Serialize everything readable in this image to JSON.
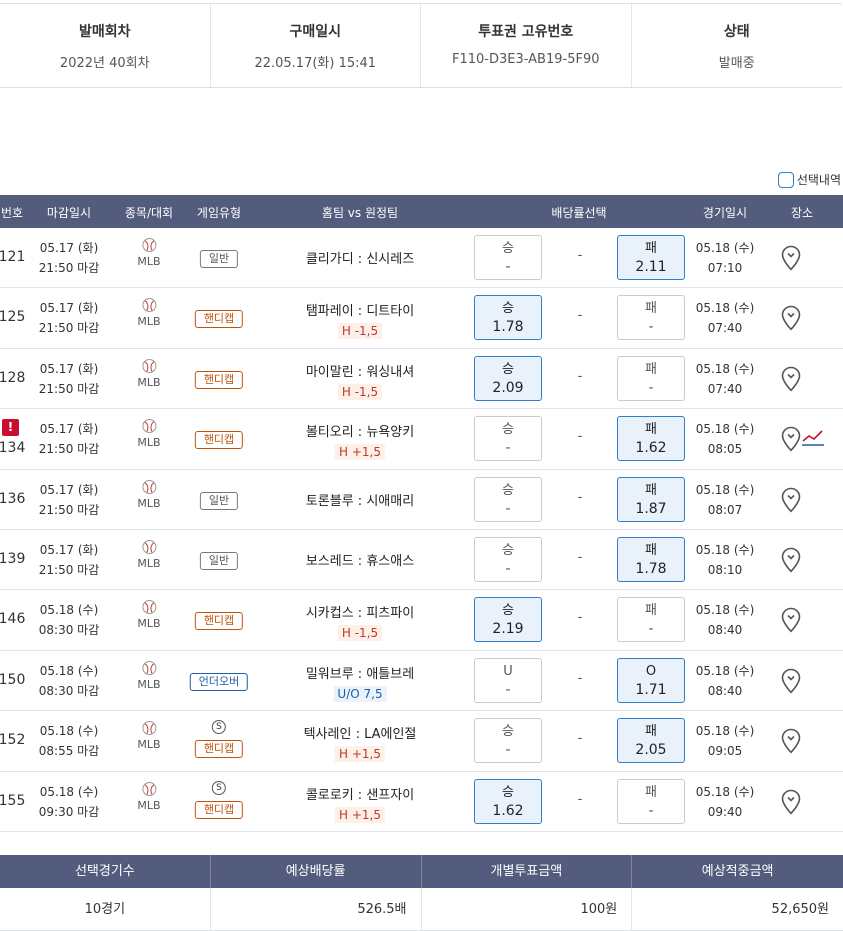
{
  "info": [
    {
      "label": "발매회차",
      "value": "2022년 40회차"
    },
    {
      "label": "구매일시",
      "value": "22.05.17(화) 15:41"
    },
    {
      "label": "투표권 고유번호",
      "value": "F110-D3E3-AB19-5F90"
    },
    {
      "label": "상태",
      "value": "발매중"
    }
  ],
  "select_toggle": "선택내역",
  "headers": {
    "num": "번호",
    "deadline": "마감일시",
    "sport": "종목/대회",
    "type": "게임유형",
    "teams": "홈팀 vs 원정팀",
    "odds": "배당률선택",
    "gametime": "경기일시",
    "venue": "장소"
  },
  "rows": [
    {
      "num": "121",
      "d1": "05.17 (화)",
      "d2": "21:50 마감",
      "sport": "MLB",
      "type": "일반",
      "kind": "normal",
      "teams": "클리가디 : 신시레즈",
      "sub": "",
      "left_label": "승",
      "left_val": "-",
      "left_sel": false,
      "mid": "-",
      "right_label": "패",
      "right_val": "2.11",
      "right_sel": true,
      "g1": "05.18 (수)",
      "g2": "07:10",
      "alert": "",
      "special": ""
    },
    {
      "num": "125",
      "d1": "05.17 (화)",
      "d2": "21:50 마감",
      "sport": "MLB",
      "type": "핸디캡",
      "kind": "handi",
      "teams": "탬파레이 : 디트타이",
      "sub": "H -1,5",
      "left_label": "승",
      "left_val": "1.78",
      "left_sel": true,
      "mid": "-",
      "right_label": "패",
      "right_val": "-",
      "right_sel": false,
      "g1": "05.18 (수)",
      "g2": "07:40",
      "alert": "",
      "special": ""
    },
    {
      "num": "128",
      "d1": "05.17 (화)",
      "d2": "21:50 마감",
      "sport": "MLB",
      "type": "핸디캡",
      "kind": "handi",
      "teams": "마이말린 : 워싱내셔",
      "sub": "H -1,5",
      "left_label": "승",
      "left_val": "2.09",
      "left_sel": true,
      "mid": "-",
      "right_label": "패",
      "right_val": "-",
      "right_sel": false,
      "g1": "05.18 (수)",
      "g2": "07:40",
      "alert": "",
      "special": ""
    },
    {
      "num": "134",
      "d1": "05.17 (화)",
      "d2": "21:50 마감",
      "sport": "MLB",
      "type": "핸디캡",
      "kind": "handi",
      "teams": "볼티오리 : 뉴욕양키",
      "sub": "H +1,5",
      "left_label": "승",
      "left_val": "-",
      "left_sel": false,
      "mid": "-",
      "right_label": "패",
      "right_val": "1.62",
      "right_sel": true,
      "g1": "05.18 (수)",
      "g2": "08:05",
      "alert": "!",
      "special": ""
    },
    {
      "num": "136",
      "d1": "05.17 (화)",
      "d2": "21:50 마감",
      "sport": "MLB",
      "type": "일반",
      "kind": "normal",
      "teams": "토론블루 : 시애매리",
      "sub": "",
      "left_label": "승",
      "left_val": "-",
      "left_sel": false,
      "mid": "-",
      "right_label": "패",
      "right_val": "1.87",
      "right_sel": true,
      "g1": "05.18 (수)",
      "g2": "08:07",
      "alert": "",
      "special": ""
    },
    {
      "num": "139",
      "d1": "05.17 (화)",
      "d2": "21:50 마감",
      "sport": "MLB",
      "type": "일반",
      "kind": "normal",
      "teams": "보스레드 : 휴스애스",
      "sub": "",
      "left_label": "승",
      "left_val": "-",
      "left_sel": false,
      "mid": "-",
      "right_label": "패",
      "right_val": "1.78",
      "right_sel": true,
      "g1": "05.18 (수)",
      "g2": "08:10",
      "alert": "",
      "special": ""
    },
    {
      "num": "146",
      "d1": "05.18 (수)",
      "d2": "08:30 마감",
      "sport": "MLB",
      "type": "핸디캡",
      "kind": "handi",
      "teams": "시카컵스 : 피츠파이",
      "sub": "H -1,5",
      "left_label": "승",
      "left_val": "2.19",
      "left_sel": true,
      "mid": "-",
      "right_label": "패",
      "right_val": "-",
      "right_sel": false,
      "g1": "05.18 (수)",
      "g2": "08:40",
      "alert": "",
      "special": ""
    },
    {
      "num": "150",
      "d1": "05.18 (수)",
      "d2": "08:30 마감",
      "sport": "MLB",
      "type": "언더오버",
      "kind": "uo",
      "teams": "밀워브루 : 애틀브레",
      "sub": "U/O 7,5",
      "left_label": "U",
      "left_val": "-",
      "left_sel": false,
      "mid": "-",
      "right_label": "O",
      "right_val": "1.71",
      "right_sel": true,
      "g1": "05.18 (수)",
      "g2": "08:40",
      "alert": "",
      "special": ""
    },
    {
      "num": "152",
      "d1": "05.18 (수)",
      "d2": "08:55 마감",
      "sport": "MLB",
      "type": "핸디캡",
      "kind": "handi",
      "teams": "텍사레인 : LA에인절",
      "sub": "H +1,5",
      "left_label": "승",
      "left_val": "-",
      "left_sel": false,
      "mid": "-",
      "right_label": "패",
      "right_val": "2.05",
      "right_sel": true,
      "g1": "05.18 (수)",
      "g2": "09:05",
      "alert": "",
      "special": "S"
    },
    {
      "num": "155",
      "d1": "05.18 (수)",
      "d2": "09:30 마감",
      "sport": "MLB",
      "type": "핸디캡",
      "kind": "handi",
      "teams": "콜로로키 : 샌프자이",
      "sub": "H +1,5",
      "left_label": "승",
      "left_val": "1.62",
      "left_sel": true,
      "mid": "-",
      "right_label": "패",
      "right_val": "-",
      "right_sel": false,
      "g1": "05.18 (수)",
      "g2": "09:40",
      "alert": "",
      "special": "S"
    }
  ],
  "summary": {
    "headers": [
      "선택경기수",
      "예상배당률",
      "개별투표금액",
      "예상적중금액"
    ],
    "values": [
      "10경기",
      "526.5배",
      "100원",
      "52,650원"
    ]
  },
  "colors": {
    "header_bg": "#545c7e",
    "selected_odd": "#e9f2fb",
    "handicap": "#c0520f",
    "underover": "#1c5ea7",
    "alert": "#c8102e"
  }
}
